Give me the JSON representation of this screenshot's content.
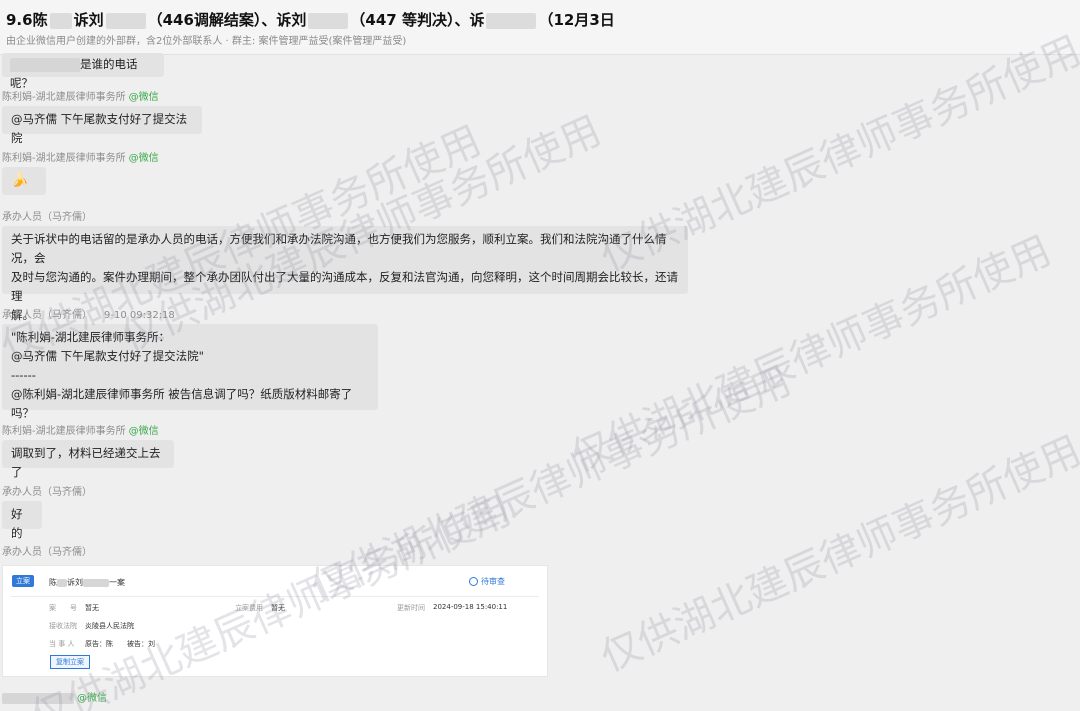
{
  "header": {
    "title_p1": "9.6陈",
    "title_p2": "诉刘",
    "title_p3": "（446调解结案）、诉刘",
    "title_p4": "（447 等判决）、诉",
    "title_p5": "（12月3日",
    "subtitle": "由企业微信用户创建的外部群，含2位外部联系人 · 群主: 案件管理严益受(案件管理严益受)"
  },
  "messages": [
    {
      "text": "是谁的电话呢？"
    },
    {
      "sender": "陈利娟-湖北建辰律师事务所",
      "wx": "@微信",
      "text": "@马齐儒 下午尾款支付好了提交法院"
    },
    {
      "sender": "陈利娟-湖北建辰律师事务所",
      "wx": "@微信",
      "emoji": "🍌"
    },
    {
      "sender": "承办人员（马齐儒）",
      "lines": [
        "关于诉状中的电话留的是承办人员的电话，方便我们和承办法院沟通，也方便我们为您服务，顺利立案。我们和法院沟通了什么情况，会",
        "及时与您沟通的。案件办理期间，整个承办团队付出了大量的沟通成本，反复和法官沟通，向您释明，这个时间周期会比较长，还请理",
        "解。"
      ]
    },
    {
      "sender": "承办人员（马齐儒）",
      "time": "9-10 09:32:18",
      "lines": [
        "\"陈利娟-湖北建辰律师事务所：",
        "@马齐儒 下午尾款支付好了提交法院\"",
        "------",
        "@陈利娟-湖北建辰律师事务所  被告信息调了吗？纸质版材料邮寄了吗？"
      ]
    },
    {
      "sender": "陈利娟-湖北建辰律师事务所",
      "wx": "@微信",
      "text": "调取到了，材料已经递交上去了"
    },
    {
      "sender": "承办人员（马齐儒）",
      "text": "好的"
    },
    {
      "sender": "承办人员（马齐儒）"
    },
    {
      "wx": "@微信"
    }
  ],
  "card": {
    "tag": "立案",
    "case_title_a": "陈",
    "case_title_b": "诉刘",
    "case_title_c": "一案",
    "status": "待审查",
    "f_no_label": "案　　号",
    "f_no_value": "暂无",
    "f_fee_label": "立案费用",
    "f_fee_value": "暂无",
    "f_time_label": "更新时间",
    "f_time_value": "2024-09-18 15:40:11",
    "f_court_label": "接收法院",
    "f_court_value": "炎陵县人民法院",
    "f_party_label": "当 事 人",
    "f_party_value": "原告：陈　　被告：刘",
    "button": "复制立案"
  },
  "watermark": "仅供湖北建辰律师事务所使用"
}
